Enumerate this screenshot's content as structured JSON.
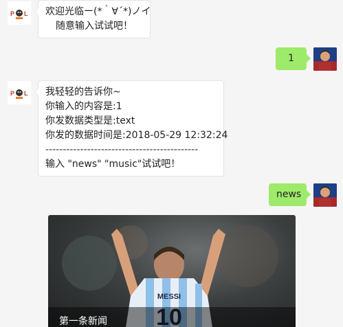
{
  "messages": [
    {
      "from": "bot",
      "lines": [
        "欢迎光临ー(*｀∀´*)ノイ",
        "随意输入试试吧！"
      ]
    },
    {
      "from": "user",
      "text": "1"
    },
    {
      "from": "bot",
      "lines": [
        "我轻轻的告诉你~",
        "你输入的内容是:1",
        "你发数据类型是:text",
        "你发的数据时间是:2018-05-29 12:32:24",
        "--------------------------------------------",
        "输入 \"news\" \"music\"试试吧！"
      ]
    },
    {
      "from": "user",
      "text": "news"
    }
  ],
  "news": {
    "title": "第一条新闻",
    "image_alt": "MESSI 10"
  },
  "avatars": {
    "bot": "PDL",
    "user_jersey": "MESSI"
  }
}
